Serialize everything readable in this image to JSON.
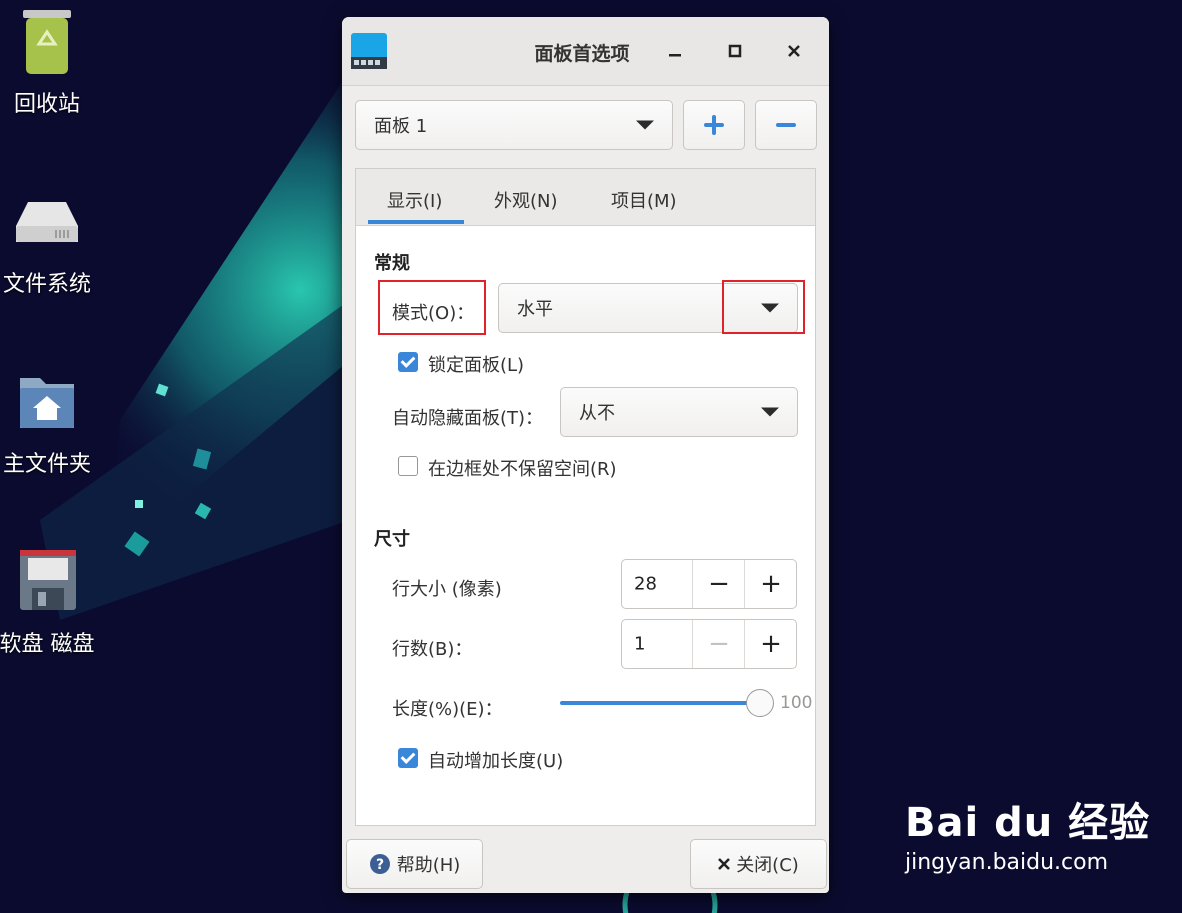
{
  "desktop": {
    "icons": [
      {
        "label": "回收站",
        "icon": "trash-icon"
      },
      {
        "label": "文件系统",
        "icon": "drive-icon"
      },
      {
        "label": "主文件夹",
        "icon": "home-folder-icon"
      },
      {
        "label": "软盘 磁盘",
        "icon": "floppy-icon"
      }
    ]
  },
  "window": {
    "title": "面板首选项",
    "controls": {
      "minimize": "–",
      "maximize": "□",
      "close": "✕"
    }
  },
  "panel_selector": {
    "value": "面板 1",
    "add": "+",
    "remove": "−"
  },
  "tabs": [
    {
      "label": "显示(I)",
      "active": true
    },
    {
      "label": "外观(N)",
      "active": false
    },
    {
      "label": "项目(M)",
      "active": false
    }
  ],
  "general": {
    "title": "常规",
    "mode_label": "模式(O)：",
    "mode_value": "水平",
    "lock_panel_label": "锁定面板(L)",
    "lock_panel_checked": true,
    "autohide_label": "自动隐藏面板(T)：",
    "autohide_value": "从不",
    "no_reserve_label": "在边框处不保留空间(R)",
    "no_reserve_checked": false
  },
  "size": {
    "title": "尺寸",
    "row_size_label": "行大小 (像素)",
    "row_size_value": "28",
    "rows_label": "行数(B)：",
    "rows_value": "1",
    "length_label": "长度(%)(E)：",
    "length_value": "100",
    "length_fraction": 1.0,
    "auto_length_label": "自动增加长度(U)",
    "auto_length_checked": true
  },
  "footer": {
    "help_label": "帮助(H)",
    "close_label": "关闭(C)"
  },
  "watermark": {
    "brand": "Bai du 经验",
    "url": "jingyan.baidu.com"
  },
  "colors": {
    "accent": "#3a86d9",
    "highlight_box": "#e0232a",
    "desktop_bg": "#0b0b30"
  }
}
